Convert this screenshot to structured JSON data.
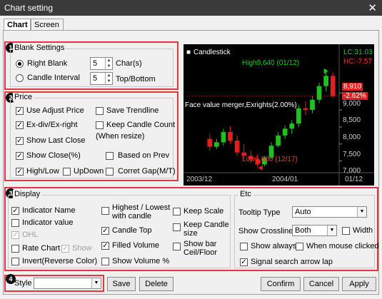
{
  "window": {
    "title": "Chart setting",
    "close_glyph": "✕"
  },
  "tabs": [
    {
      "label": "Chart"
    },
    {
      "label": "Screen"
    }
  ],
  "badges": [
    "1",
    "2",
    "3",
    "4"
  ],
  "blank": {
    "group_label": "Blank Settings",
    "right_blank_label": "Right Blank",
    "right_blank_value": "5",
    "right_blank_unit": "Char(s)",
    "candle_interval_label": "Candle Interval",
    "candle_interval_value": "5",
    "candle_interval_unit": "Top/Bottom"
  },
  "price": {
    "group_label": "Price",
    "adjust_price": "Use Adjust Price",
    "ex_div": "Ex-div/Ex-right",
    "show_last_close": "Show Last Close",
    "show_close_pct": "Show Close(%)",
    "high_low": "High/Low",
    "updown": "UpDown",
    "save_trendline": "Save Trendline",
    "keep_candle_count": "Keep Candle Count",
    "when_resize": "(When resize)",
    "based_on_prev": "Based on Prev",
    "corret_gap": "Corret Gap(M/T)"
  },
  "display": {
    "group_label": "Display",
    "indicator_name": "Indicator Name",
    "indicator_value": "Indicator value",
    "ohl": "OHL",
    "rate_chart": "Rate Chart",
    "rate_show": "Show",
    "invert": "Invert(Reverse Color)",
    "highest_lowest": "Highest / Lowest",
    "with_candle": "with candle",
    "candle_top": "Candle Top",
    "filled_volume": "Filled Volume",
    "show_volume_pct": "Show Volume %",
    "keep_scale": "Keep Scale",
    "keep_candle_size_1": "Keep Candle",
    "keep_candle_size_2": "size",
    "show_bar_1": "Show bar",
    "show_bar_2": "Ceil/Floor"
  },
  "etc": {
    "group_label": "Etc",
    "tooltip_type_label": "Tooltip Type",
    "tooltip_type_value": "Auto",
    "show_crossline_label": "Show Crossline",
    "show_crossline_value": "Both",
    "width": "Width",
    "show_always": "Show always",
    "when_mouse_clicked": "When mouse clicked",
    "signal_search": "Signal search arrow lap"
  },
  "bottom": {
    "style_label": "Style",
    "style_value": "",
    "save": "Save",
    "delete": "Delete",
    "confirm": "Confirm",
    "cancel": "Cancel",
    "apply": "Apply"
  },
  "chart_data": {
    "type": "candlestick",
    "title": "Candlestick",
    "lc": "LC:31.03",
    "hc": "HC:-7.57",
    "high_label": "High9,640 (01/12)",
    "low_label": "Low6,800 (12/17)",
    "event_label": "Face value merger,Exrights(2.00%)",
    "last_price": "8,910",
    "last_change": "-2.62%",
    "y_ticks": [
      "9,000",
      "8,500",
      "8,000",
      "7,500",
      "7,000"
    ],
    "x_ticks": [
      "2003/12",
      "2004/01",
      "01/12"
    ],
    "ylim": [
      6700,
      9800
    ],
    "candles": [
      {
        "o": 7650,
        "h": 7800,
        "l": 7300,
        "c": 7420
      },
      {
        "o": 7420,
        "h": 7650,
        "l": 7350,
        "c": 7550
      },
      {
        "o": 7550,
        "h": 7950,
        "l": 7450,
        "c": 7850
      },
      {
        "o": 7850,
        "h": 8020,
        "l": 7500,
        "c": 7600
      },
      {
        "o": 7600,
        "h": 7750,
        "l": 7150,
        "c": 7250
      },
      {
        "o": 7250,
        "h": 7500,
        "l": 7050,
        "c": 7150
      },
      {
        "o": 7150,
        "h": 7300,
        "l": 6950,
        "c": 7050
      },
      {
        "o": 7050,
        "h": 7200,
        "l": 6800,
        "c": 6900
      },
      {
        "o": 6900,
        "h": 7150,
        "l": 6850,
        "c": 7100
      },
      {
        "o": 7100,
        "h": 7550,
        "l": 7050,
        "c": 7450
      },
      {
        "o": 7450,
        "h": 7850,
        "l": 7400,
        "c": 7750
      },
      {
        "o": 7750,
        "h": 8050,
        "l": 7650,
        "c": 7950
      },
      {
        "o": 7950,
        "h": 8200,
        "l": 7800,
        "c": 8100
      },
      {
        "o": 8100,
        "h": 8650,
        "l": 8000,
        "c": 8550
      },
      {
        "o": 8550,
        "h": 8750,
        "l": 8350,
        "c": 8500
      },
      {
        "o": 8500,
        "h": 8900,
        "l": 8400,
        "c": 8800
      },
      {
        "o": 8800,
        "h": 9300,
        "l": 8700,
        "c": 9200
      },
      {
        "o": 9200,
        "h": 9640,
        "l": 9050,
        "c": 9500
      },
      {
        "o": 9500,
        "h": 9600,
        "l": 8850,
        "c": 8910
      }
    ],
    "colors": {
      "up": "#20c020",
      "down": "#e02020",
      "bg": "#000000"
    }
  }
}
